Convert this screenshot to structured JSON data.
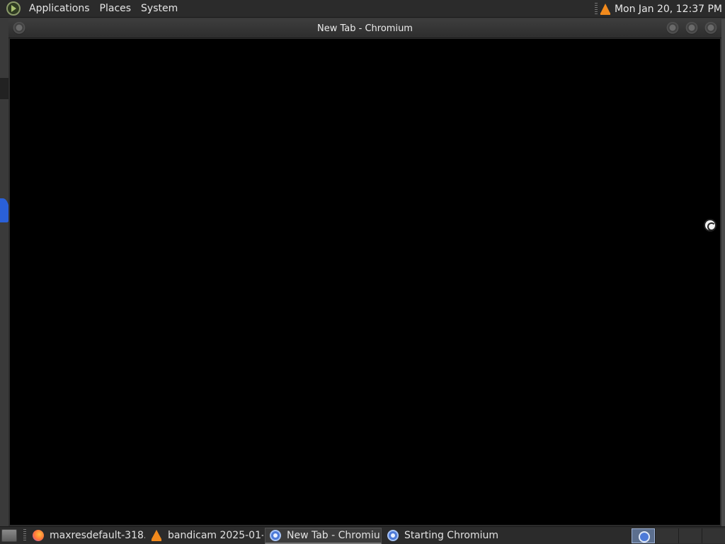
{
  "top_panel": {
    "menus": [
      "Applications",
      "Places",
      "System"
    ],
    "clock": "Mon Jan 20, 12:37 PM",
    "tray_icon": "vlc-icon"
  },
  "window": {
    "title": "New Tab - Chromium",
    "content_state": "loading"
  },
  "taskbar": {
    "tasks": [
      {
        "label": "maxresdefault-318...",
        "icon": "firefox-icon",
        "active": false
      },
      {
        "label": "bandicam 2025-01-...",
        "icon": "vlc-icon",
        "active": false
      },
      {
        "label": "New Tab - Chromium",
        "icon": "chromium-icon",
        "active": true
      },
      {
        "label": "Starting Chromium",
        "icon": "chromium-icon",
        "active": false
      }
    ],
    "workspaces_count": 4,
    "active_workspace": 1
  },
  "colors": {
    "panel": "#2b2b2b",
    "window_content": "#000000",
    "accent": "#5c6f8e"
  }
}
